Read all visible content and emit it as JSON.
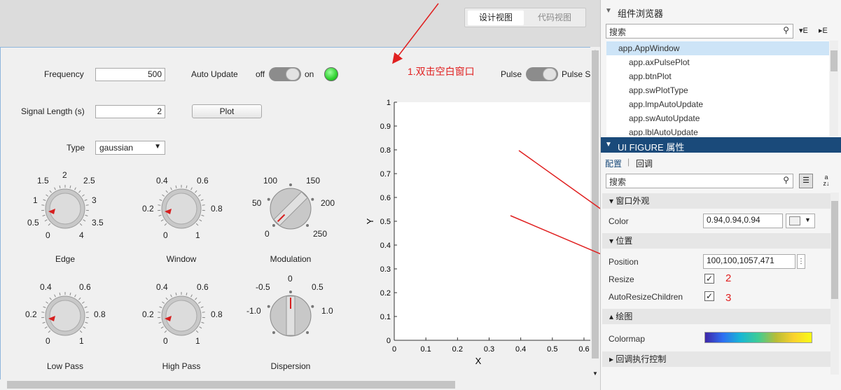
{
  "tabs": {
    "design": "设计视图",
    "code": "代码视图"
  },
  "controls": {
    "frequency_label": "Frequency",
    "frequency_value": "500",
    "auto_update_label": "Auto Update",
    "off": "off",
    "on": "on",
    "pulse_label": "Pulse",
    "pulse_s_label": "Pulse S",
    "signal_length_label": "Signal Length (s)",
    "signal_length_value": "2",
    "plot_button": "Plot",
    "type_label": "Type",
    "type_value": "gaussian"
  },
  "knobs": [
    {
      "name": "Edge",
      "ticks": [
        "1.5",
        "2",
        "2.5",
        "1",
        "3",
        "0.5",
        "3.5",
        "0",
        "4"
      ]
    },
    {
      "name": "Window",
      "ticks": [
        "0.4",
        "0.6",
        "0.2",
        "0.8",
        "0",
        "1"
      ]
    },
    {
      "name": "Modulation",
      "ticks": [
        "100",
        "150",
        "50",
        "200",
        "0",
        "250"
      ]
    },
    {
      "name": "Low Pass",
      "ticks": [
        "0.4",
        "0.6",
        "0.2",
        "0.8",
        "0",
        "1"
      ]
    },
    {
      "name": "High Pass",
      "ticks": [
        "0.4",
        "0.6",
        "0.2",
        "0.8",
        "0",
        "1"
      ]
    },
    {
      "name": "Dispersion",
      "ticks": [
        "-0.5",
        "0",
        "0.5",
        "-1.0",
        "1.0"
      ]
    }
  ],
  "chart_data": {
    "type": "line",
    "xlabel": "X",
    "ylabel": "Y",
    "x_ticks": [
      "0",
      "0.1",
      "0.2",
      "0.3",
      "0.4",
      "0.5",
      "0.6"
    ],
    "y_ticks": [
      "0",
      "0.1",
      "0.2",
      "0.3",
      "0.4",
      "0.5",
      "0.6",
      "0.7",
      "0.8",
      "0.9",
      "1"
    ],
    "xlim": [
      0,
      0.62
    ],
    "ylim": [
      0,
      1
    ],
    "series": []
  },
  "browser": {
    "title": "组件浏览器",
    "search_placeholder": "搜索",
    "items": [
      "app.AppWindow",
      "app.axPulsePlot",
      "app.btnPlot",
      "app.swPlotType",
      "app.lmpAutoUpdate",
      "app.swAutoUpdate",
      "app.lblAutoUpdate"
    ]
  },
  "props": {
    "title": "UI FIGURE 属性",
    "tab_config": "配置",
    "tab_callback": "回调",
    "search_placeholder": "搜索",
    "sections": {
      "appearance": "窗口外观",
      "position": "位置",
      "plot": "绘图",
      "callback_control": "回调执行控制"
    },
    "color_label": "Color",
    "color_value": "0.94,0.94,0.94",
    "position_label": "Position",
    "position_value": "100,100,1057,471",
    "resize_label": "Resize",
    "autoresize_label": "AutoResizeChildren",
    "colormap_label": "Colormap"
  },
  "annotations": {
    "step1": "1.双击空白窗口",
    "step2": "2",
    "step3": "3"
  },
  "colors": {
    "accent": "#1a4a7a",
    "annotation": "#e02020",
    "lamp": "#2fd12f"
  }
}
